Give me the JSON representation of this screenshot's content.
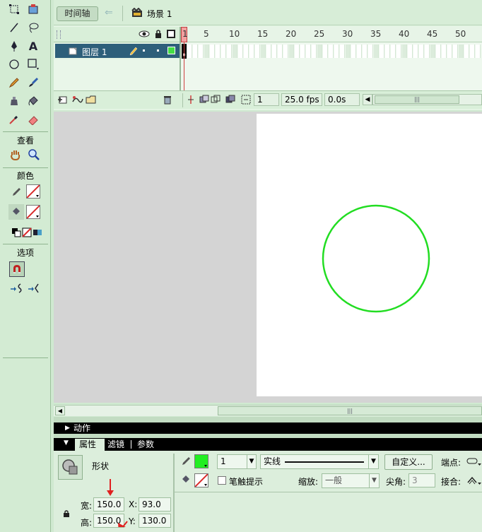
{
  "toolbar": {
    "view_label": "查看",
    "color_label": "颜色",
    "options_label": "选项",
    "text_tool_glyph": "A",
    "icons": [
      "free-transform-icon",
      "gradient-transform-icon",
      "line-icon",
      "lasso-icon",
      "pen-icon",
      "text-icon",
      "oval-icon",
      "rectangle-icon",
      "pencil-icon",
      "brush-icon",
      "ink-bottle-icon",
      "paint-bucket-icon",
      "eyedropper-icon",
      "eraser-icon",
      "hand-icon",
      "zoom-icon"
    ],
    "colors": {
      "stroke": "#00ff00",
      "fill": "none",
      "accent": "#d92b2b"
    }
  },
  "timeline": {
    "timeline_button": "时间轴",
    "scene_label": "场景 1",
    "layer_name": "图层 1",
    "ruler_numbers": [
      "1",
      "5",
      "10",
      "15",
      "20",
      "25",
      "30",
      "35",
      "40",
      "45",
      "50"
    ],
    "current_frame": "1",
    "fps": "25.0 fps",
    "elapsed": "0.0s"
  },
  "stage": {
    "shape": "circle",
    "stroke_color": "#22dd22"
  },
  "panels": {
    "actions_label": "动作",
    "tabs": [
      "属性",
      "滤镜",
      "参数"
    ],
    "shape_label": "形状",
    "width_label": "宽:",
    "width_value": "150.0",
    "height_label": "高:",
    "height_value": "150.0",
    "x_label": "X:",
    "x_value": "93.0",
    "y_label": "Y:",
    "y_value": "130.0",
    "stroke_size": "1",
    "stroke_style": "实线",
    "custom_button": "自定义...",
    "cap_label": "端点:",
    "stroke_hint_label": "笔触提示",
    "scale_label": "缩放:",
    "scale_value": "一般",
    "miter_label": "尖角:",
    "miter_value": "3",
    "join_label": "接合:"
  }
}
